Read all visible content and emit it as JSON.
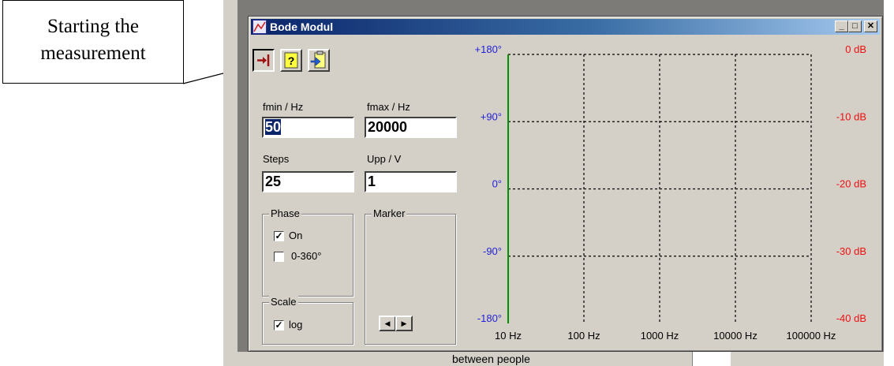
{
  "annotation": {
    "line1": "Starting the",
    "line2": "measurement"
  },
  "window": {
    "title": "Bode Modul",
    "controls": {
      "minimize": "_",
      "maximize": "□",
      "close": "✕"
    }
  },
  "toolbar": {
    "start_icon": "start-measurement-icon",
    "help_icon": "help-icon",
    "export_icon": "export-icon"
  },
  "form": {
    "fmin_label": "fmin / Hz",
    "fmin_value": "50",
    "fmax_label": "fmax / Hz",
    "fmax_value": "20000",
    "steps_label": "Steps",
    "steps_value": "25",
    "upp_label": "Upp / V",
    "upp_value": "1"
  },
  "phase_group": {
    "title": "Phase",
    "on_label": "On",
    "on_checked": true,
    "range_label": "0-360°",
    "range_checked": false
  },
  "marker_group": {
    "title": "Marker"
  },
  "scale_group": {
    "title": "Scale",
    "log_label": "log",
    "log_checked": true
  },
  "chart": {
    "left_ticks": [
      "+180°",
      "+90°",
      "0°",
      "-90°",
      "-180°"
    ],
    "right_ticks": [
      "0 dB",
      "-10 dB",
      "-20 dB",
      "-30 dB",
      "-40 dB"
    ],
    "x_ticks": [
      "10 Hz",
      "100 Hz",
      "1000 Hz",
      "10000 Hz",
      "100000 Hz"
    ],
    "colors": {
      "phase_axis": "#1f1fd8",
      "db_axis": "#ee1010",
      "y_axis_line": "#009000"
    }
  },
  "background": {
    "partial_text": "between people"
  }
}
